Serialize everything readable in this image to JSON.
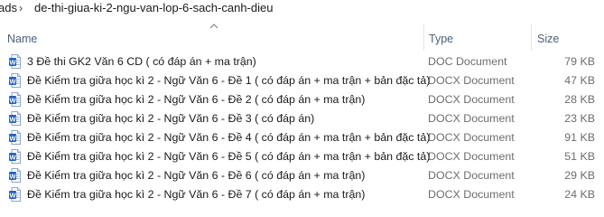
{
  "breadcrumb": {
    "previous": "ads",
    "separator": "›",
    "current": "de-thi-giua-ki-2-ngu-van-lop-6-sach-canh-dieu"
  },
  "columns": {
    "name": "Name",
    "type": "Type",
    "size": "Size",
    "sort_indicator": "sort-ascending-icon"
  },
  "files": [
    {
      "name": "3 Đề thi GK2 Văn 6 CD ( có đáp án + ma trận)",
      "type": "DOC Document",
      "size": "79 KB",
      "icon": "word-doc-icon"
    },
    {
      "name": "Đề Kiểm tra giữa học kì 2 - Ngữ Văn 6 - Đề 1  ( có đáp án + ma trận + bản đặc tả)",
      "type": "DOCX Document",
      "size": "47 KB",
      "icon": "word-docx-icon"
    },
    {
      "name": "Đề Kiểm tra giữa học kì 2 - Ngữ Văn 6 - Đề 2  ( có đáp án + ma trận)",
      "type": "DOCX Document",
      "size": "28 KB",
      "icon": "word-docx-icon"
    },
    {
      "name": "Đề Kiểm tra giữa học kì 2 - Ngữ Văn 6 - Đề 3  ( có đáp án)",
      "type": "DOCX Document",
      "size": "23 KB",
      "icon": "word-docx-icon"
    },
    {
      "name": "Đề Kiểm tra giữa học kì 2 - Ngữ Văn 6 - Đề 4  ( có đáp án + ma trận + bản đặc tả)",
      "type": "DOCX Document",
      "size": "91 KB",
      "icon": "word-docx-icon"
    },
    {
      "name": "Đề Kiểm tra giữa học kì 2 - Ngữ Văn 6 - Đề 5  ( có đáp án + ma trận + bản đặc tả)",
      "type": "DOCX Document",
      "size": "51 KB",
      "icon": "word-docx-icon"
    },
    {
      "name": "Đề Kiểm tra giữa học kì 2 - Ngữ Văn 6 - Đề 6  ( có đáp án + ma trận)",
      "type": "DOCX Document",
      "size": "29 KB",
      "icon": "word-docx-icon"
    },
    {
      "name": "Đề Kiểm tra giữa học kì 2 - Ngữ Văn 6 - Đề 7  ( có đáp án + ma trận)",
      "type": "DOCX Document",
      "size": "24 KB",
      "icon": "word-docx-icon"
    }
  ],
  "colors": {
    "header_text": "#4c607a",
    "secondary_text": "#6d6d6d",
    "word_blue": "#1f5fbf"
  }
}
